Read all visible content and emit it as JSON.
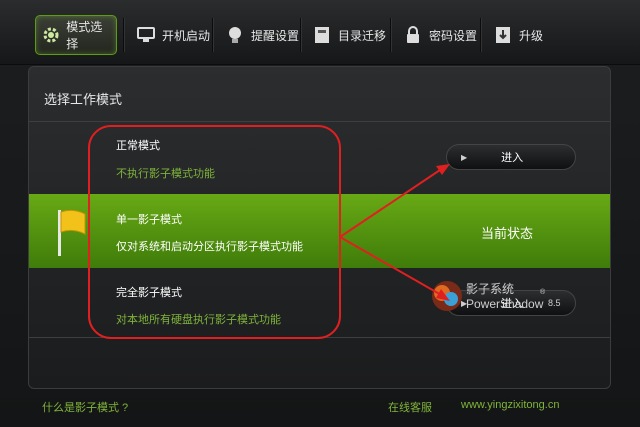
{
  "window": {
    "min_label": "▪",
    "close_label": "×"
  },
  "toolbar": {
    "tabs": [
      {
        "label": "模式选择",
        "icon": "gear-icon"
      },
      {
        "label": "开机启动",
        "icon": "monitor-icon"
      },
      {
        "label": "提醒设置",
        "icon": "bulb-icon"
      },
      {
        "label": "目录迁移",
        "icon": "folder-icon"
      },
      {
        "label": "密码设置",
        "icon": "lock-icon"
      },
      {
        "label": "升级",
        "icon": "upgrade-icon"
      }
    ]
  },
  "panel": {
    "title": "选择工作模式",
    "modes": [
      {
        "title": "正常模式",
        "desc": "不执行影子模式功能",
        "action": "进入"
      },
      {
        "title": "单一影子模式",
        "desc": "仅对系统和启动分区执行影子模式功能",
        "status": "当前状态"
      },
      {
        "title": "完全影子模式",
        "desc": "对本地所有硬盘执行影子模式功能",
        "action": "进入"
      }
    ],
    "logo": {
      "name_cn": "影子系统",
      "name_en": "PowerShadow",
      "version": "8.5",
      "reg": "®"
    }
  },
  "footer": {
    "help_link": "什么是影子模式 ?",
    "support_link": "在线客服",
    "site_link": "www.yingzixitong.cn"
  },
  "colors": {
    "accent": "#7fb43a",
    "band": "#5a9a12",
    "annotation": "#e02020"
  }
}
